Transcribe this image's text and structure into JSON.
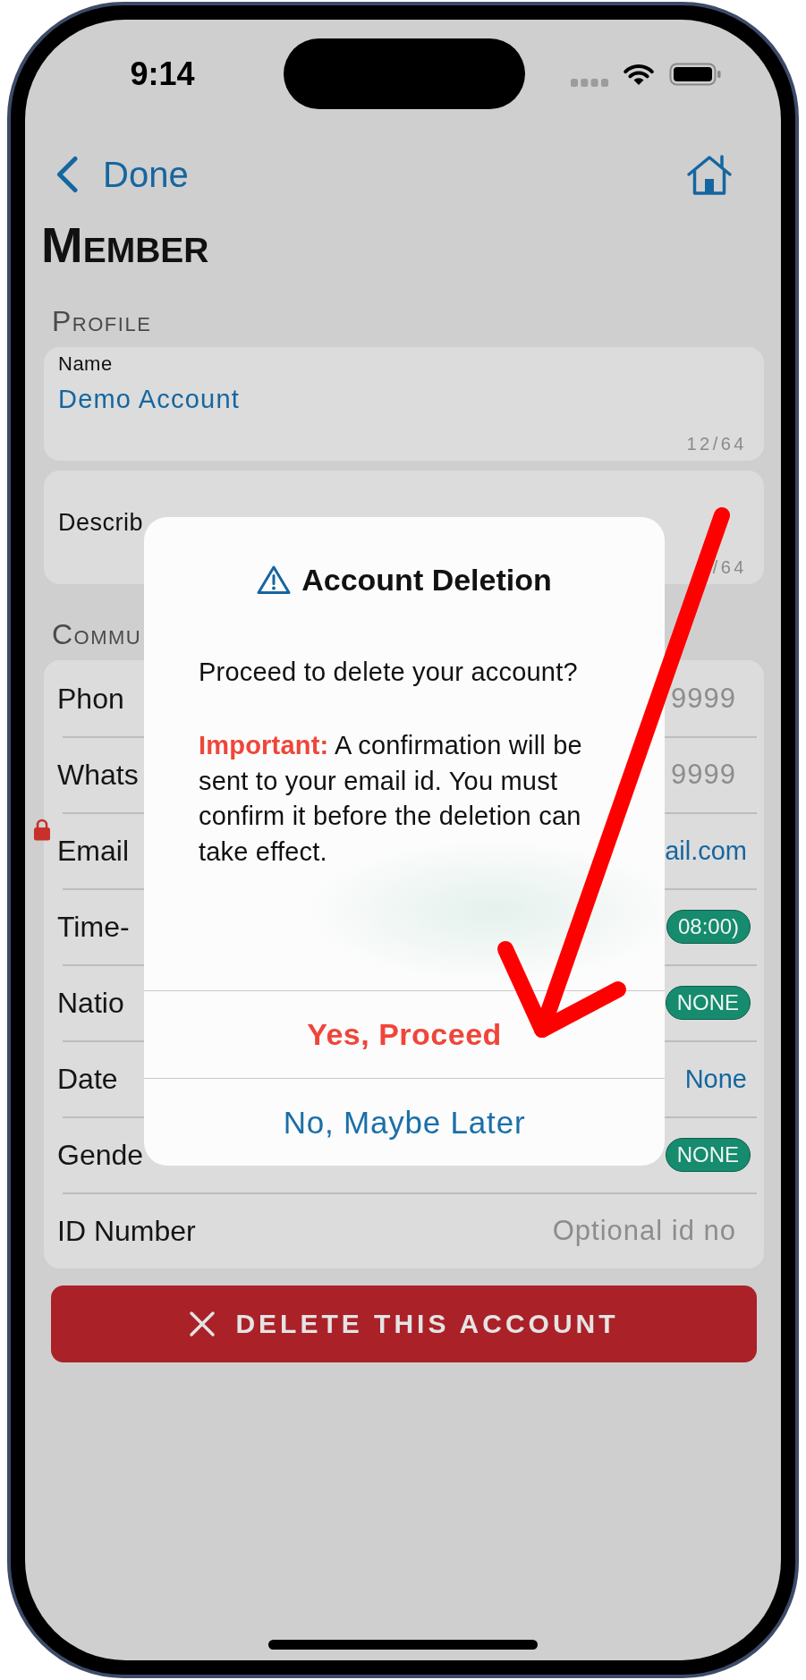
{
  "status_bar": {
    "time": "9:14"
  },
  "nav_bar": {
    "back_label": "Done"
  },
  "title": "Member",
  "profile": {
    "header": "Profile",
    "fields": [
      {
        "label": "Name",
        "value": "Demo Account",
        "counter": "12/64"
      },
      {
        "label": "Describ",
        "counter": "/64"
      }
    ]
  },
  "communication": {
    "header": "Commu",
    "rows": [
      {
        "label": "Phon",
        "kind": "input",
        "placeholder": "9999",
        "locked": false
      },
      {
        "label": "Whats",
        "kind": "input",
        "placeholder": "9999",
        "locked": false
      },
      {
        "label": "Email",
        "kind": "link",
        "value": "ail.com",
        "locked": true
      },
      {
        "label": "Time-",
        "kind": "chip",
        "value": "08:00)",
        "locked": false
      },
      {
        "label": "Natio",
        "kind": "chip",
        "value": "NONE",
        "locked": false
      },
      {
        "label": "Date",
        "kind": "link",
        "value": "None",
        "locked": false
      },
      {
        "label": "Gende",
        "kind": "chip",
        "value": "NONE",
        "locked": false
      },
      {
        "label": "ID Number",
        "kind": "input",
        "placeholder": "Optional id no",
        "locked": false
      }
    ]
  },
  "delete_button": {
    "label": "DELETE THIS ACCOUNT"
  },
  "dialog": {
    "title": "Account Deletion",
    "message": "Proceed to delete your account?",
    "note": "**Important:** A confirmation will be sent to your email id. You must confirm it before the deletion can take effect.",
    "actions": [
      {
        "label": "Yes, Proceed",
        "kind": "destructive"
      },
      {
        "label": "No, Maybe Later",
        "kind": "cancel"
      }
    ]
  }
}
